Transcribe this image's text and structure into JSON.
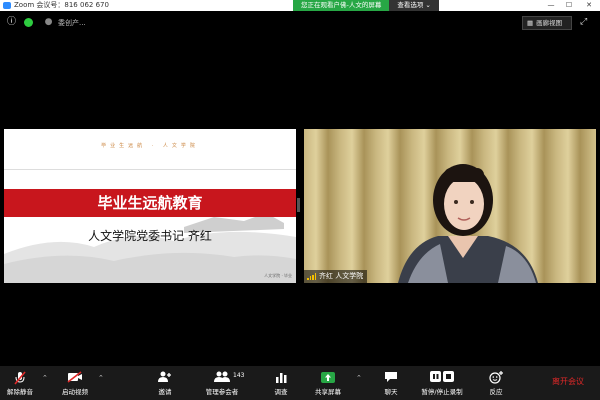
{
  "titlebar": {
    "title": "Zoom 会议号：816 062 670",
    "minimize": "—",
    "maximize": "☐",
    "close": "✕"
  },
  "banner": {
    "text": "您正在观看户佛-人文的屏幕",
    "options": "查看选项 ⌄"
  },
  "topbar": {
    "meeting_name": "委创产..."
  },
  "view": {
    "gallery_label": "画廊视图"
  },
  "slide": {
    "top_text": "毕业生远航 · 人文学院",
    "title": "毕业生远航教育",
    "subtitle": "人文学院党委书记  齐红",
    "footer": "人文学院 · 毕业"
  },
  "video": {
    "name_label": "齐红  人文学院"
  },
  "toolbar": {
    "mute_label": "解除静音",
    "video_label": "启动视频",
    "invite_label": "邀请",
    "participants_label": "管理参会者",
    "participants_count": "143",
    "poll_label": "调查",
    "share_label": "共享屏幕",
    "chat_label": "聊天",
    "record_label": "暂停/停止录制",
    "reactions_label": "反应",
    "end_label": "离开会议"
  },
  "colors": {
    "accent_blue": "#2d8cff",
    "banner_green": "#27a745",
    "slide_red": "#c8161d",
    "end_red": "#e02828"
  }
}
